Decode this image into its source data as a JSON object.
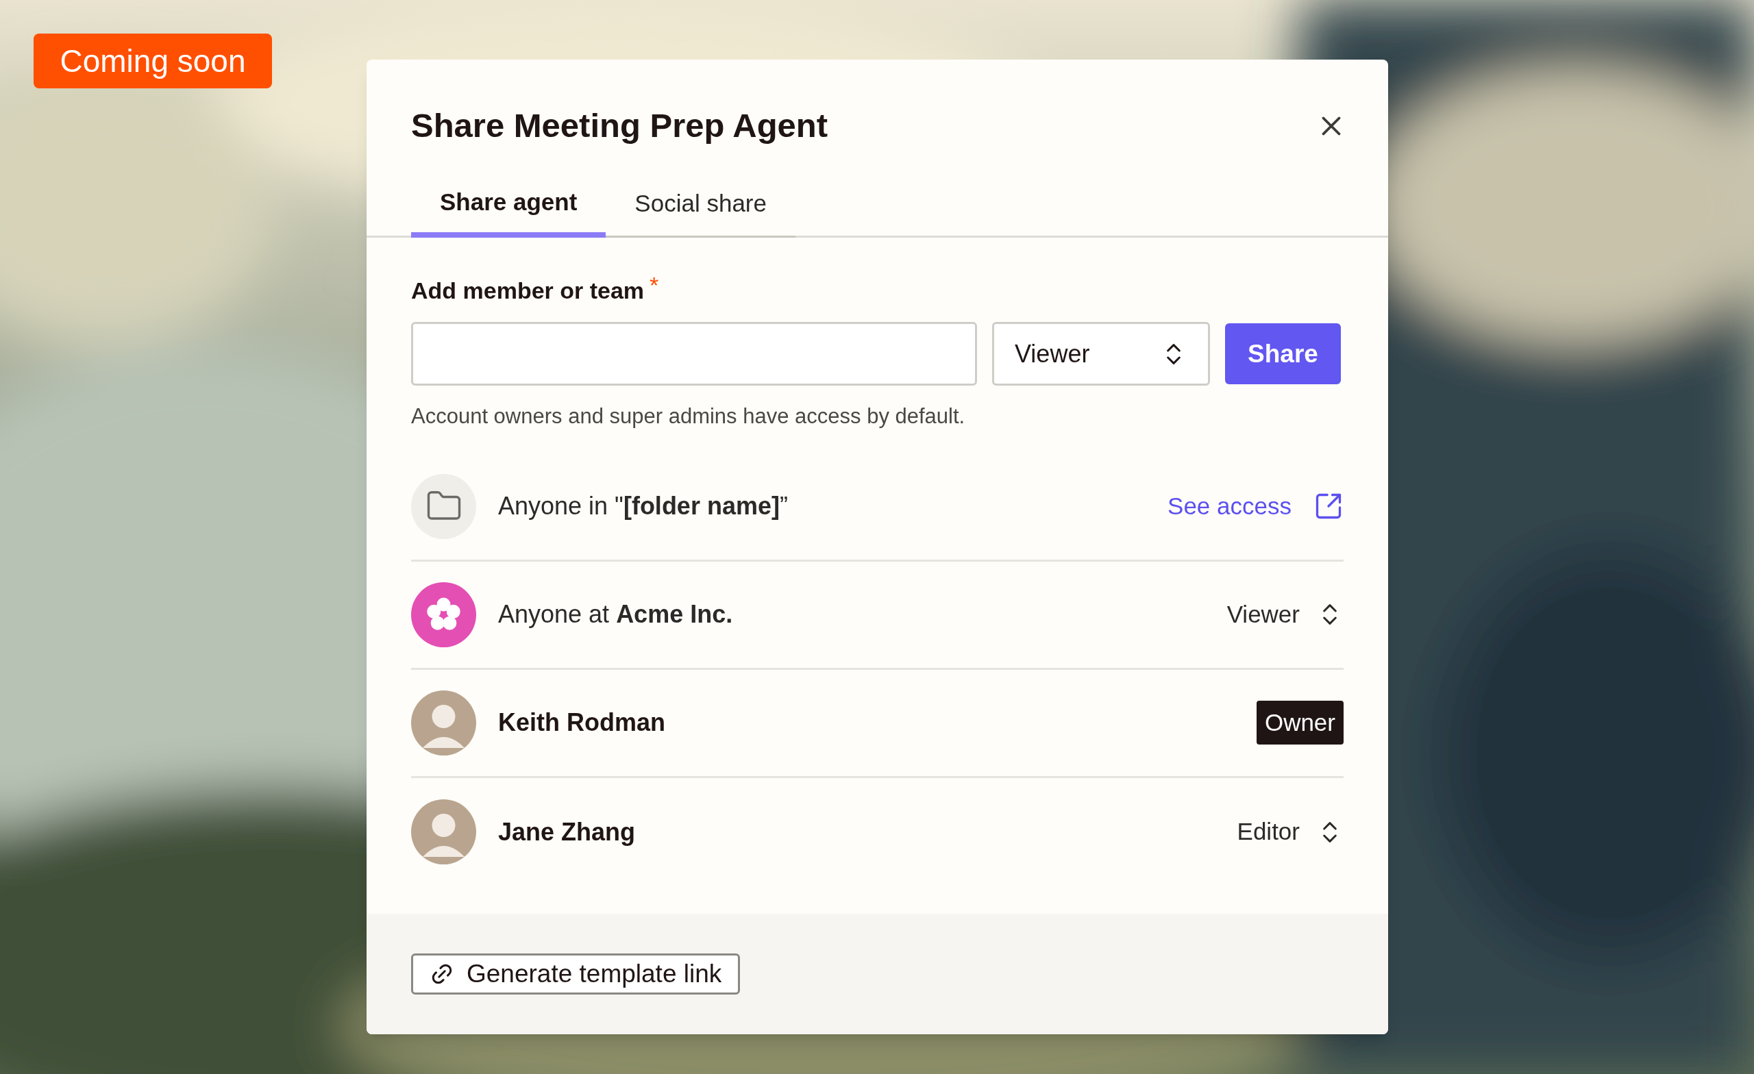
{
  "badge": "Coming soon",
  "dialog": {
    "title": "Share Meeting Prep Agent",
    "tabs": [
      {
        "label": "Share agent",
        "selected": true
      },
      {
        "label": "Social share",
        "selected": false
      }
    ],
    "field": {
      "label": "Add member or team",
      "required_mark": "*"
    },
    "role_select": "Viewer",
    "share_button": "Share",
    "helper": "Account owners and super admins have access by default.",
    "access": [
      {
        "kind": "folder",
        "text": "Anyone in \"**[folder name]**”",
        "action": {
          "kind": "link",
          "text": "See access"
        }
      },
      {
        "kind": "org",
        "text": "Anyone at **Acme Inc.**",
        "action": {
          "kind": "select",
          "text": "Viewer"
        }
      },
      {
        "kind": "person",
        "text": "Keith Rodman",
        "action": {
          "kind": "badge",
          "text": "Owner"
        }
      },
      {
        "kind": "person",
        "text": "Jane Zhang",
        "action": {
          "kind": "select",
          "text": "Editor"
        }
      }
    ],
    "footer_button": "Generate template link"
  }
}
